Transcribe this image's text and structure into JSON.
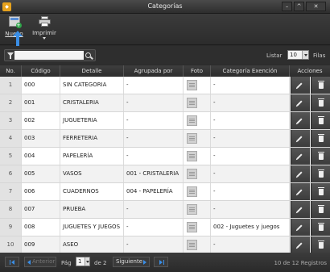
{
  "window": {
    "title": "Categorías",
    "app_icon": "app-logo-icon",
    "controls": [
      "minimize",
      "maximize",
      "close"
    ],
    "control_glyphs": [
      "–",
      "^",
      "✕"
    ]
  },
  "toolbar": {
    "nuevo_label": "Nuevo",
    "imprimir_label": "Imprimir"
  },
  "filter": {
    "input_value": "",
    "listar_label": "Listar",
    "listar_value": "10",
    "filas_label": "Filas"
  },
  "table": {
    "headers": [
      "No.",
      "Código",
      "Detalle",
      "Agrupada por",
      "Foto",
      "Categoría Exención",
      "Acciones"
    ],
    "rows": [
      {
        "no": "1",
        "codigo": "000",
        "detalle": "SIN CATEGORIA",
        "agrupada": "-",
        "exencion": "-"
      },
      {
        "no": "2",
        "codigo": "001",
        "detalle": "CRISTALERIA",
        "agrupada": "-",
        "exencion": "-"
      },
      {
        "no": "3",
        "codigo": "002",
        "detalle": "JUGUETERIA",
        "agrupada": "-",
        "exencion": "-"
      },
      {
        "no": "4",
        "codigo": "003",
        "detalle": "FERRETERIA",
        "agrupada": "-",
        "exencion": "-"
      },
      {
        "no": "5",
        "codigo": "004",
        "detalle": "PAPELERÍA",
        "agrupada": "-",
        "exencion": "-"
      },
      {
        "no": "6",
        "codigo": "005",
        "detalle": "VASOS",
        "agrupada": "001 - CRISTALERIA",
        "exencion": "-"
      },
      {
        "no": "7",
        "codigo": "006",
        "detalle": "CUADERNOS",
        "agrupada": "004 - PAPELERÍA",
        "exencion": "-"
      },
      {
        "no": "8",
        "codigo": "007",
        "detalle": "PRUEBA",
        "agrupada": "-",
        "exencion": "-"
      },
      {
        "no": "9",
        "codigo": "008",
        "detalle": "JUGUETES Y JUEGOS",
        "agrupada": "-",
        "exencion": "002 - Juguetes y juegos"
      },
      {
        "no": "10",
        "codigo": "009",
        "detalle": "ASEO",
        "agrupada": "-",
        "exencion": "-"
      }
    ]
  },
  "pager": {
    "prev_label": "Anterior",
    "pag_label": "Pág",
    "current_page": "1",
    "of_label": "de 2",
    "next_label": "Siguiente",
    "info": "10 de 12 Registros"
  },
  "colors": {
    "accent": "#3a8ee6",
    "dark_chrome": "#2b2b2b",
    "app_icon": "#e6a21d"
  }
}
